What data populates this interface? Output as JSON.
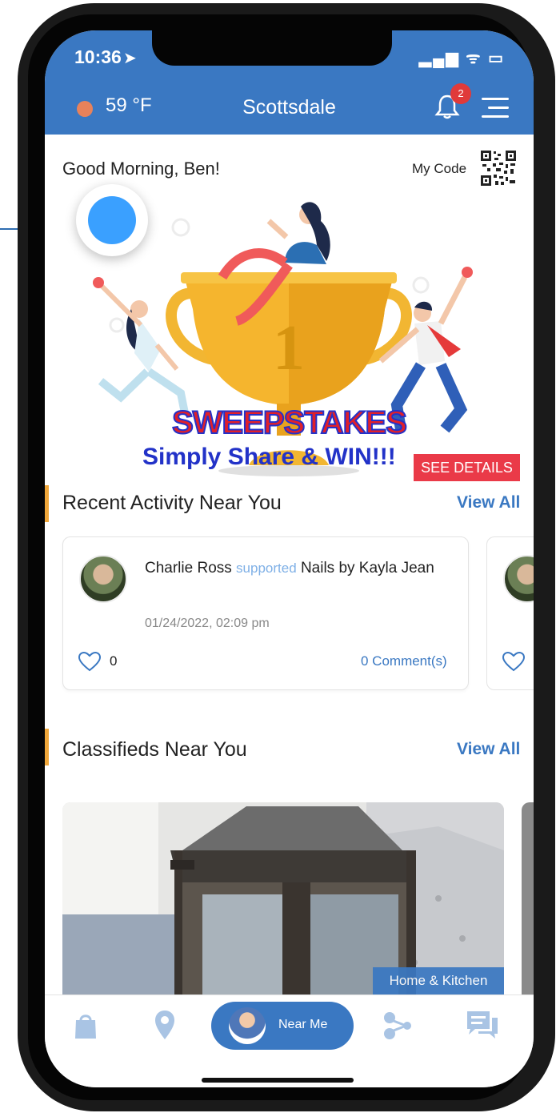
{
  "status_bar": {
    "time": "10:36",
    "signal_icons": "▂▄▆ ᯤ ▭"
  },
  "header": {
    "temperature": "59 °F",
    "city": "Scottsdale",
    "notification_count": "2"
  },
  "greeting": "Good Morning, Ben!",
  "my_code_label": "My Code",
  "banner": {
    "title": "SWEEPSTAKES",
    "subtitle": "Simply Share & WIN!!!",
    "trophy_number": "1",
    "details_button": "SEE DETAILS"
  },
  "recent_activity": {
    "title": "Recent Activity Near You",
    "view_all": "View All",
    "items": [
      {
        "user": "Charlie Ross",
        "action": "supported",
        "business": "Nails by Kayla Jean",
        "date": "01/24/2022, 02:09 pm",
        "likes": "0",
        "comments": "0 Comment(s)"
      }
    ]
  },
  "classifieds": {
    "title": "Classifieds Near You",
    "view_all": "View All",
    "items": [
      {
        "category": "Home & Kitchen"
      }
    ]
  },
  "bottom_nav": {
    "items": [
      {
        "icon": "shopping-bag-icon"
      },
      {
        "icon": "location-pin-icon"
      },
      {
        "label": "Near Me"
      },
      {
        "icon": "network-icon"
      },
      {
        "icon": "chat-icon"
      }
    ]
  },
  "colors": {
    "primary": "#3a78c2",
    "accent_bar": "#f0a73a",
    "badge_red": "#e03a3a",
    "details_red": "#ea3a48",
    "floating_dot": "#3aa0ff"
  }
}
